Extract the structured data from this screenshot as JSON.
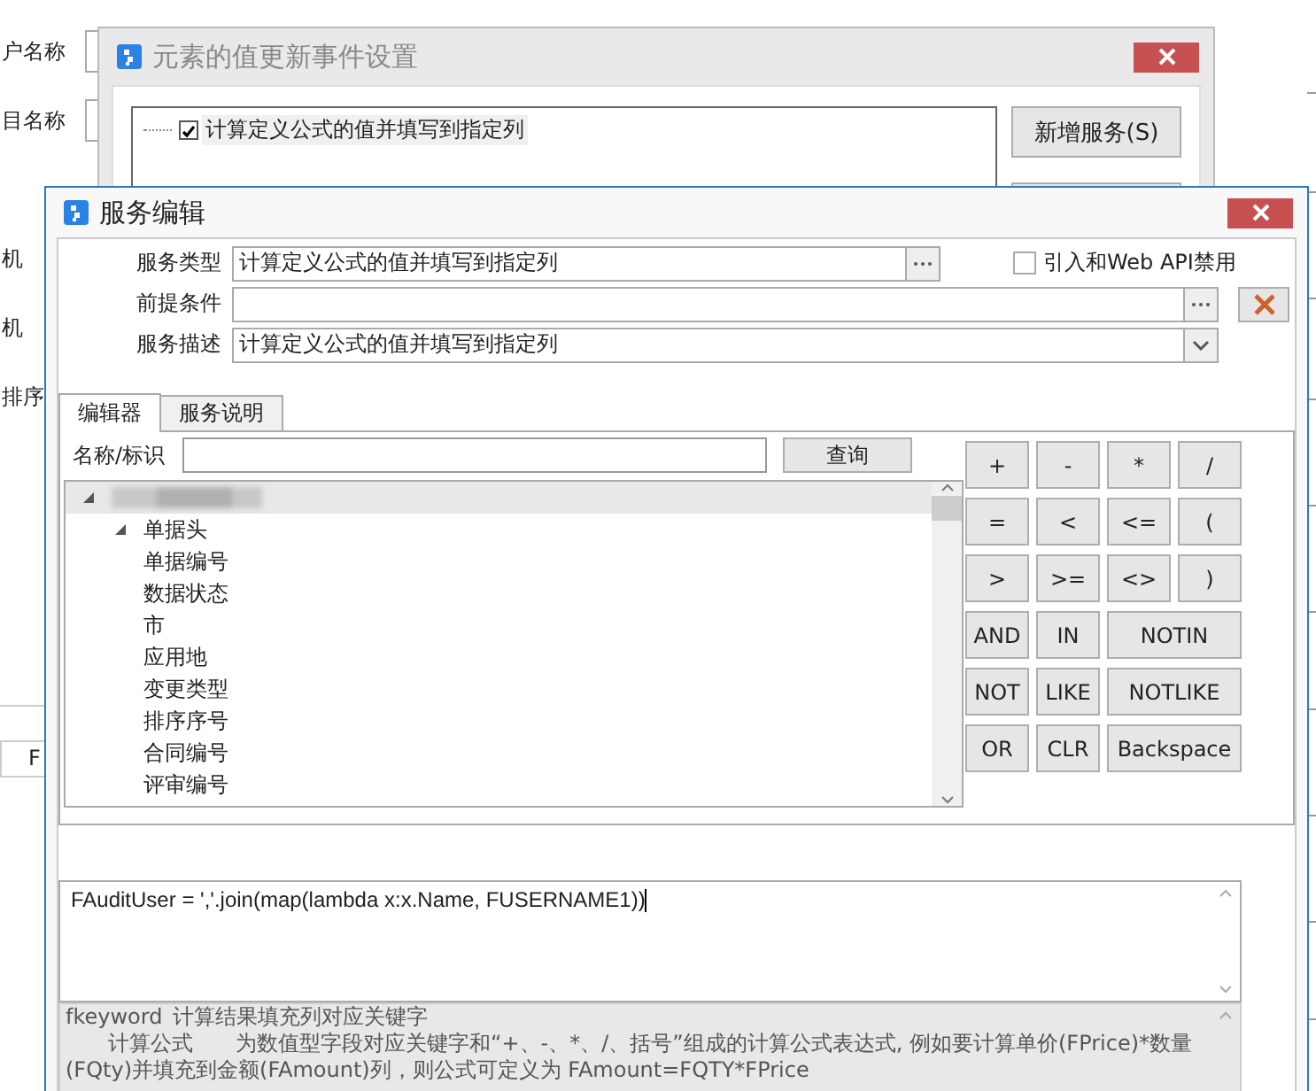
{
  "background_form": {
    "labels": [
      "户名称",
      "目名称",
      "机",
      "机",
      "排序"
    ],
    "table_cells": [
      "F"
    ]
  },
  "event_dialog": {
    "title": "元素的值更新事件设置",
    "services": [
      {
        "label": "计算定义公式的值并填写到指定列",
        "checked": true
      }
    ],
    "buttons": [
      "新增服务(S)"
    ]
  },
  "service_dialog": {
    "title": "服务编辑",
    "fields": [
      {
        "label": "服务类型",
        "value": "计算定义公式的值并填写到指定列",
        "kind": "browse"
      },
      {
        "label": "前提条件",
        "kind": "browse"
      },
      {
        "label": "服务描述",
        "value": "计算定义公式的值并填写到指定列",
        "kind": "dropdown"
      }
    ],
    "web_api_disabled": {
      "label": "引入和Web API禁用",
      "checked": false
    },
    "tabs": [
      {
        "label": "编辑器",
        "selected": true
      },
      {
        "label": "服务说明",
        "selected": false
      }
    ],
    "search": {
      "label": "名称/标识",
      "button": "查询"
    },
    "tree": [
      {
        "kind": "redacted",
        "expanded": true,
        "children": [
          {
            "label": "单据头",
            "expanded": true,
            "children": [
              {
                "label": "单据编号"
              },
              {
                "label": "数据状态"
              },
              {
                "label": "市"
              },
              {
                "label": "应用地"
              },
              {
                "label": "变更类型"
              },
              {
                "label": "排序序号"
              },
              {
                "label": "合同编号"
              },
              {
                "label": "评审编号"
              }
            ]
          }
        ]
      }
    ],
    "operators": [
      {
        "label": "+",
        "kind": "narrow"
      },
      {
        "label": "-",
        "kind": "narrow"
      },
      {
        "label": "*",
        "kind": "narrow"
      },
      {
        "label": "/",
        "kind": "narrow"
      },
      {
        "label": "=",
        "kind": "narrow"
      },
      {
        "label": "<",
        "kind": "narrow"
      },
      {
        "label": "<=",
        "kind": "narrow"
      },
      {
        "label": "(",
        "kind": "narrow"
      },
      {
        "label": ">",
        "kind": "narrow"
      },
      {
        "label": ">=",
        "kind": "narrow"
      },
      {
        "label": "<>",
        "kind": "narrow"
      },
      {
        "label": ")",
        "kind": "narrow"
      },
      {
        "label": "AND",
        "kind": "narrow"
      },
      {
        "label": "IN",
        "kind": "narrow"
      },
      {
        "label": "NOTIN",
        "kind": "wide"
      },
      {
        "label": "NOT",
        "kind": "narrow"
      },
      {
        "label": "LIKE",
        "kind": "narrow"
      },
      {
        "label": "NOTLIKE",
        "kind": "wide"
      },
      {
        "label": "OR",
        "kind": "narrow"
      },
      {
        "label": "CLR",
        "kind": "narrow"
      },
      {
        "label": "Backspace",
        "kind": "wide"
      }
    ],
    "formula": "FAuditUser = ','.join(map(lambda x:x.Name, FUSERNAME1))",
    "help": [
      {
        "term": "fkeyword",
        "text": "计算结果填充列对应关键字"
      },
      {
        "term": "计算公式",
        "text": "为数值型字段对应关键字和“+、-、*、/、括号”组成的计算公式表达式, 例如要计算单价(FPrice)*数量(FQty)并填充到金额(FAmount)列，则公式可定义为 FAmount=FQTY*FPrice"
      }
    ]
  }
}
